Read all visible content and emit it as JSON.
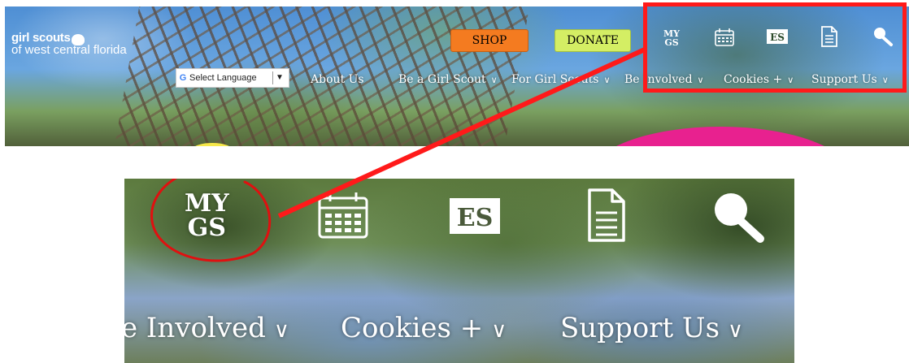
{
  "header": {
    "logo": {
      "brand": "girl scouts",
      "council": "of west central florida"
    },
    "buttons": {
      "shop": "SHOP",
      "donate": "DONATE"
    },
    "language": {
      "label": "Select Language",
      "g_icon": "G"
    },
    "nav": [
      {
        "label": "About Us",
        "has_menu": false
      },
      {
        "label": "Be a Girl Scout",
        "has_menu": true
      },
      {
        "label": "For Girl Scouts",
        "has_menu": true
      },
      {
        "label": "Be Involved",
        "has_menu": true
      },
      {
        "label": "Cookies +",
        "has_menu": true
      },
      {
        "label": "Support Us",
        "has_menu": true
      }
    ],
    "icons": [
      {
        "name": "mygs-icon",
        "text_line1": "MY",
        "text_line2": "GS"
      },
      {
        "name": "calendar-icon"
      },
      {
        "name": "es-language-icon",
        "text": "ES"
      },
      {
        "name": "document-icon"
      },
      {
        "name": "search-icon"
      }
    ],
    "colors": {
      "shop": "#f47b20",
      "donate": "#d4ee64",
      "highlight": "#ff1a1a",
      "pink": "#e8218f"
    }
  },
  "zoom": {
    "icons": {
      "mygs_line1": "MY",
      "mygs_line2": "GS",
      "es": "ES"
    },
    "nav": [
      {
        "label": "e Involved"
      },
      {
        "label": "Cookies +"
      },
      {
        "label": "Support Us"
      }
    ]
  }
}
